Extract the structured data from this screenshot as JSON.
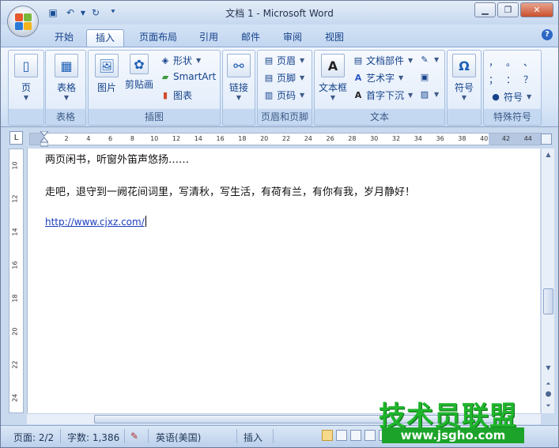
{
  "window": {
    "title": "文档 1 - Microsoft Word"
  },
  "qat": {
    "save_icon": "save-icon",
    "undo_icon": "undo-icon",
    "redo_icon": "redo-icon",
    "customize_icon": "customize-dropdown-icon"
  },
  "tabs": [
    {
      "label": "开始"
    },
    {
      "label": "插入"
    },
    {
      "label": "页面布局"
    },
    {
      "label": "引用"
    },
    {
      "label": "邮件"
    },
    {
      "label": "审阅"
    },
    {
      "label": "视图"
    }
  ],
  "active_tab": "插入",
  "ribbon": {
    "pages_group": {
      "button": "页"
    },
    "table_group": {
      "button": "表格",
      "caption": "表格"
    },
    "illustrations_group": {
      "caption": "插图",
      "picture": "图片",
      "clipart": "剪贴画",
      "shapes": "形状",
      "smartart": "SmartArt",
      "chart": "图表"
    },
    "links_group": {
      "button": "链接"
    },
    "header_footer_group": {
      "caption": "页眉和页脚",
      "header": "页眉",
      "footer": "页脚",
      "page_number": "页码"
    },
    "text_group": {
      "caption": "文本",
      "textbox": "文本框",
      "quickparts": "文档部件",
      "wordart": "艺术字",
      "dropcap": "首字下沉"
    },
    "symbols_group": {
      "button": "符号"
    },
    "special_symbols_group": {
      "caption": "特殊符号",
      "symbol_button": "符号",
      "symbols": [
        "，",
        "。",
        "、",
        "；",
        "：",
        "？"
      ]
    }
  },
  "ruler": {
    "ticks": [
      "2",
      "4",
      "6",
      "8",
      "10",
      "12",
      "14",
      "16",
      "18",
      "20",
      "22",
      "24",
      "26",
      "28",
      "30",
      "32",
      "34",
      "36",
      "38",
      "40",
      "42",
      "44"
    ],
    "vticks": [
      "10",
      "12",
      "14",
      "16",
      "18",
      "20",
      "22",
      "24"
    ]
  },
  "document": {
    "line1": "两页闲书，听窗外笛声悠扬……",
    "line2": "走吧，退守到一阙花间词里，写清秋，写生活，有荷有兰，有你有我，岁月静好！",
    "link": "http://www.cjxz.com/"
  },
  "statusbar": {
    "page": "页面: 2/2",
    "words": "字数: 1,386",
    "language": "英语(美国)",
    "mode": "插入"
  },
  "watermark": {
    "text": "技术员联盟",
    "url": "www.jsgho.com"
  },
  "colors": {
    "ribbon_bg": "#dbe8f8",
    "text_blue": "#15428b",
    "link_blue": "#1a3dbd",
    "watermark_green": "#1fb52c"
  }
}
